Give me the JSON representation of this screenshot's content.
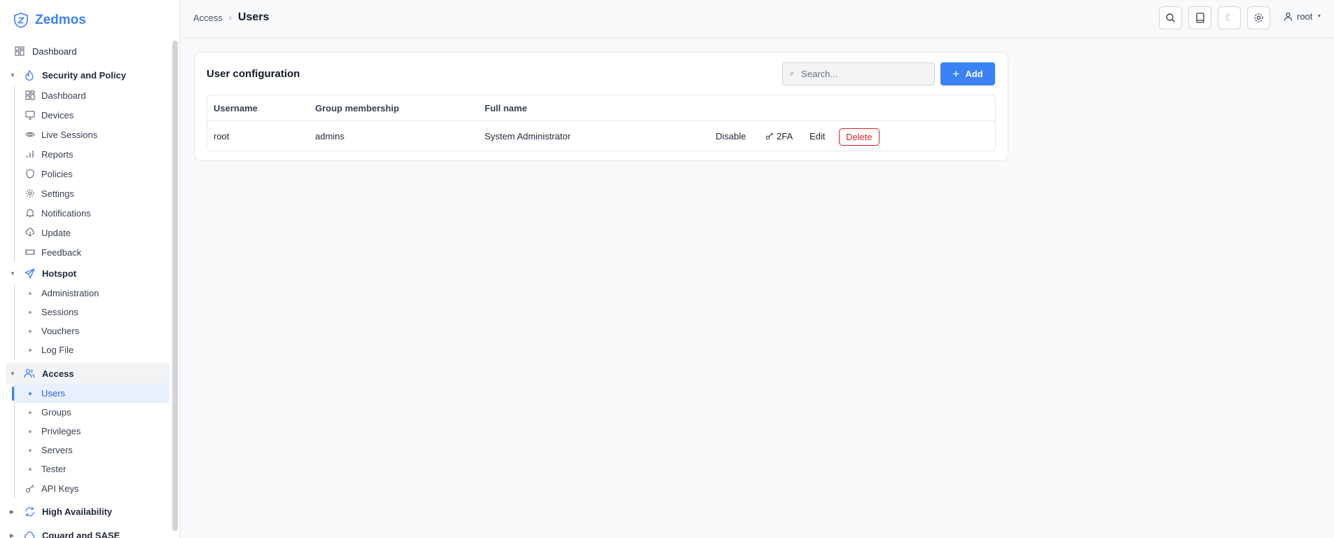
{
  "brand": {
    "name": "Zedmos",
    "accent": "#3b82f6"
  },
  "sidebar": {
    "top_item": "Dashboard",
    "security": {
      "label": "Security and Policy",
      "items": [
        "Dashboard",
        "Devices",
        "Live Sessions",
        "Reports",
        "Policies",
        "Settings",
        "Notifications",
        "Update",
        "Feedback"
      ]
    },
    "hotspot": {
      "label": "Hotspot",
      "items": [
        "Administration",
        "Sessions",
        "Vouchers",
        "Log File"
      ]
    },
    "access": {
      "label": "Access",
      "items": [
        "Users",
        "Groups",
        "Privileges",
        "Servers",
        "Tester",
        "API Keys"
      ]
    },
    "ha": {
      "label": "High Availability"
    },
    "cut_off": {
      "label": "Cguard and SASE"
    }
  },
  "breadcrumb": {
    "parent": "Access",
    "current": "Users"
  },
  "user_menu": {
    "label": "root"
  },
  "card": {
    "title": "User configuration",
    "search_placeholder": "Search...",
    "add_label": "Add"
  },
  "table": {
    "columns": [
      "Username",
      "Group membership",
      "Full name"
    ],
    "rows": [
      {
        "username": "root",
        "group": "admins",
        "full_name": "System Administrator",
        "actions": {
          "disable": "Disable",
          "twofa": "2FA",
          "edit": "Edit",
          "delete": "Delete"
        }
      }
    ]
  }
}
